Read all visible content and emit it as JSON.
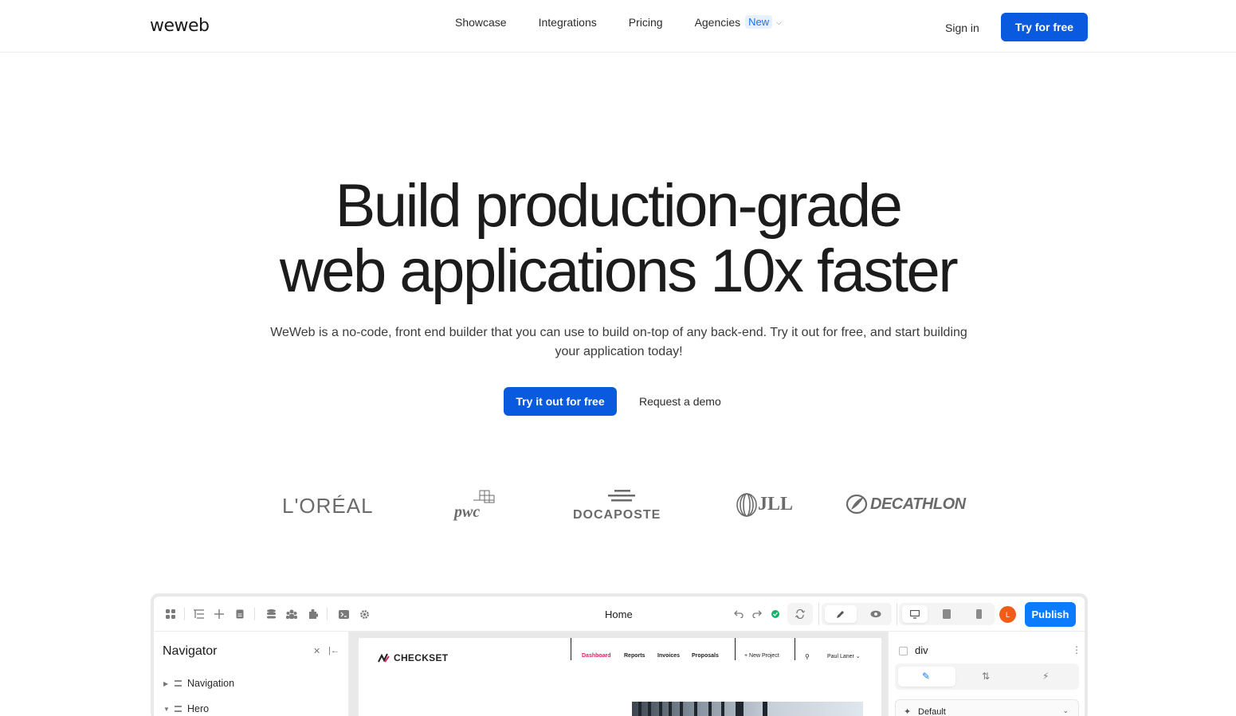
{
  "brand": {
    "logo": "weweb"
  },
  "nav": {
    "links": [
      "Showcase",
      "Integrations",
      "Pricing"
    ],
    "agencies": "Agencies",
    "agencies_badge": "New",
    "signin": "Sign in",
    "cta": "Try for free"
  },
  "hero": {
    "line1": "Build production-grade",
    "line2": "web applications 10x faster",
    "subtitle": "WeWeb is a no-code, front end builder that you can use to build on-top of any back-end. Try it out for free, and start building your application today!",
    "primary_cta": "Try it out for free",
    "secondary_cta": "Request a demo"
  },
  "customers": {
    "oreal": "L'ORÉAL",
    "pwc": "pwc",
    "docaposte": "DOCAPOSTE",
    "jll": "JLL",
    "decathlon": "DECATHLON"
  },
  "editor": {
    "page_title": "Home",
    "avatar_initial": "L",
    "publish": "Publish",
    "navigator": {
      "title": "Navigator",
      "items": [
        "Navigation",
        "Hero"
      ]
    },
    "canvas": {
      "brand": "CHECKSET",
      "links": [
        "Dashboard",
        "Reports",
        "Invoices",
        "Proposals"
      ],
      "new_project": "+ New Project",
      "user": "Paul Laner ⌄"
    },
    "properties": {
      "element": "div",
      "state": "Default"
    }
  },
  "colors": {
    "primary": "#0a5ae0",
    "publish": "#0b7cff",
    "badge_bg": "#e6f0ff",
    "badge_text": "#1f6feb",
    "avatar": "#f25c19",
    "active_link": "#e0245e"
  },
  "icons": {
    "toolbar": [
      "apps-icon",
      "tree-icon",
      "plus-icon",
      "page-icon",
      "database-icon",
      "users-icon",
      "plugin-icon",
      "terminal-icon",
      "gear-icon",
      "undo-icon",
      "redo-icon",
      "status-check-icon",
      "sync-icon",
      "edit-icon",
      "preview-eye-icon",
      "desktop-icon",
      "tablet-icon",
      "mobile-icon"
    ]
  }
}
